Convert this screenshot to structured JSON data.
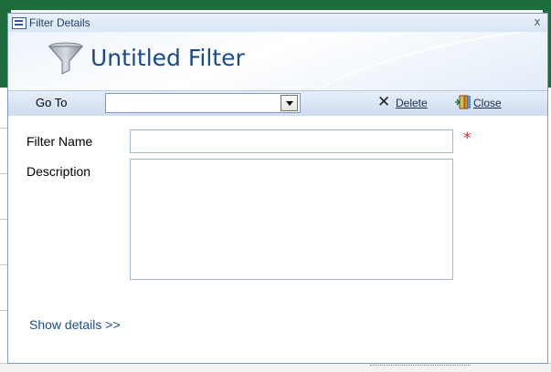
{
  "window": {
    "title": "Filter Details",
    "close_glyph": "x"
  },
  "header": {
    "title": "Untitled Filter",
    "icon": "funnel-icon"
  },
  "toolbar": {
    "goto_label": "Go To",
    "goto_value": "",
    "delete_label": "Delete",
    "close_label": "Close"
  },
  "form": {
    "filter_name_label": "Filter Name",
    "filter_name_value": "",
    "required_marker": "*",
    "description_label": "Description",
    "description_value": ""
  },
  "footer": {
    "show_details_label": "Show details >>"
  },
  "colors": {
    "accent": "#1a4a8a",
    "link": "#1e4f8c",
    "required": "#e02020",
    "toolbar_bg": "#dbe6f4"
  }
}
